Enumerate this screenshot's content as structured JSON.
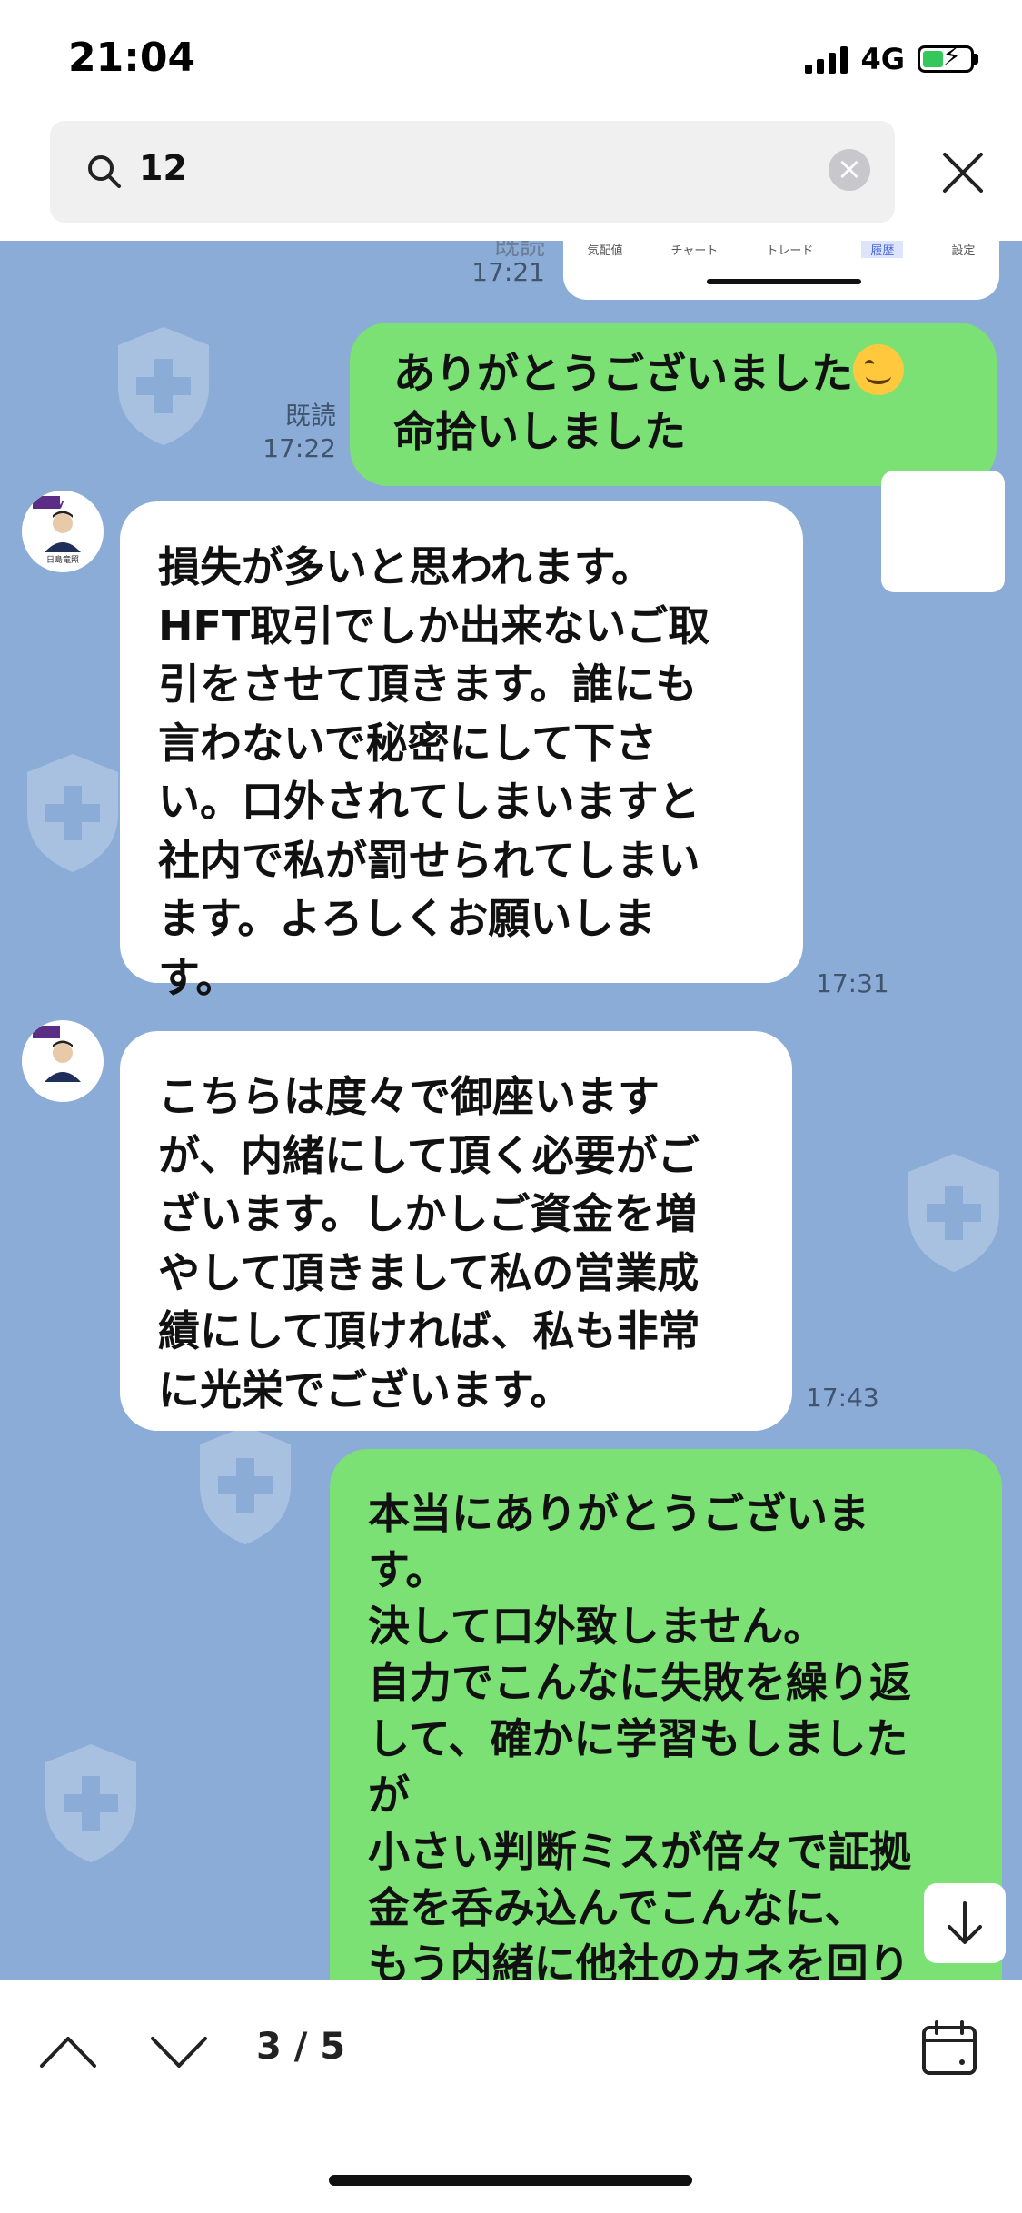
{
  "status": {
    "time": "21:04",
    "network": "4G"
  },
  "search": {
    "query": "12",
    "icon": "search-icon",
    "clear_icon": "clear-icon",
    "close_icon": "close-icon"
  },
  "image_preview": {
    "read_label": "既読",
    "time": "17:21",
    "tabs": [
      "気配値",
      "チャート",
      "トレード",
      "履歴",
      "設定"
    ],
    "active_tab": "履歴"
  },
  "messages": [
    {
      "side": "right",
      "read": "既読",
      "time": "17:22",
      "text": "ありがとうございました",
      "text2": "命拾いしました",
      "emoji": "smiling-face"
    },
    {
      "side": "left",
      "time": "17:31",
      "text": "損失が多いと思われます。\nHFT取引でしか出来ないご取\n引をさせて頂きます。誰にも\n言わないで秘密にして下さ\nい。口外されてしまいますと\n社内で私が罰せられてしまい\nます。よろしくお願いしま\nす。"
    },
    {
      "side": "left",
      "time": "17:43",
      "text": "こちらは度々で御座います\nが、内緒にして頂く必要がご\nざいます。しかしご資金を増\nやして頂きまして私の営業成\n績にして頂ければ、私も非常\nに光栄でございます。"
    },
    {
      "side": "right",
      "text": "本当にありがとうございま\nす。\n決して口外致しません。\n自力でこんなに失敗を繰り返\nして、確かに学習もしました\nが\n小さい判断ミスが倍々で証拠\n金を呑み込んでこんなに、\nもう内緒に他社のカネを回り"
    }
  ],
  "avatar": {
    "brand": "olly",
    "name": "日島竜照"
  },
  "bottom": {
    "counter": "3 / 5"
  },
  "colors": {
    "chat_bg": "#8cacd8",
    "my_bubble": "#7be174",
    "their_bubble": "#ffffff"
  }
}
